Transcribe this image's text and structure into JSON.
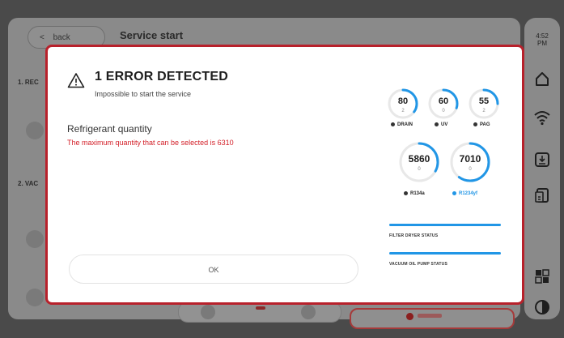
{
  "app": {
    "back_label": "back",
    "page_title": "Service start",
    "section_1_label": "1. REC",
    "section_2_label": "2. VAC",
    "time": "4:52\nPM"
  },
  "modal": {
    "title": "1 ERROR DETECTED",
    "subtitle": "Impossible to start the service",
    "field_label": "Refrigerant quantity",
    "error_message": "The maximum quantity that can be selected is 6310",
    "ok_label": "OK"
  },
  "gauges_small": [
    {
      "value": "80",
      "sub": "2",
      "label": "DRAIN",
      "fill": 0.35
    },
    {
      "value": "60",
      "sub": "0",
      "label": "UV",
      "fill": 0.3
    },
    {
      "value": "55",
      "sub": "2",
      "label": "PAG",
      "fill": 0.25
    }
  ],
  "gauges_large": [
    {
      "value": "5860",
      "sub": "0",
      "label": "R134a",
      "fill": 0.33
    },
    {
      "value": "7010",
      "sub": "0",
      "label": "R1234yf",
      "fill": 0.6
    }
  ],
  "status": {
    "filter_label": "FILTER DRYER STATUS",
    "pump_label": "VACUUM OIL PUMP STATUS"
  },
  "colors": {
    "accent": "#2196e6",
    "error": "#d32029",
    "modal_border": "#b8212b"
  },
  "icons": [
    "warning-icon",
    "home-icon",
    "wifi-icon",
    "download-icon",
    "report-icon",
    "grid-icon",
    "contrast-icon"
  ]
}
